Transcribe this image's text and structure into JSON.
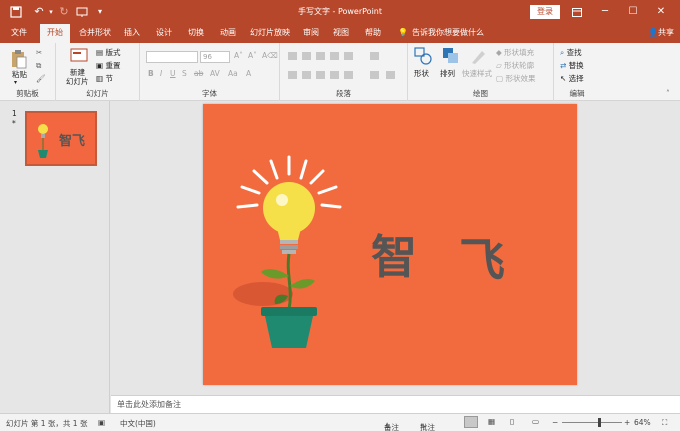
{
  "window": {
    "title": "手写文字 - PowerPoint",
    "login": "登录",
    "share": "共享",
    "tell_me": "告诉我你想要做什么"
  },
  "tabs": [
    {
      "label": "文件"
    },
    {
      "label": "开始"
    },
    {
      "label": "合并形状"
    },
    {
      "label": "插入"
    },
    {
      "label": "设计"
    },
    {
      "label": "切换"
    },
    {
      "label": "动画"
    },
    {
      "label": "幻灯片放映"
    },
    {
      "label": "审阅"
    },
    {
      "label": "视图"
    },
    {
      "label": "帮助"
    }
  ],
  "ribbon": {
    "clipboard": {
      "paste": "粘贴",
      "group": "剪贴板"
    },
    "slides": {
      "new_slide": "新建",
      "new_slide2": "幻灯片",
      "layout": "版式",
      "reset": "重置",
      "section": "节",
      "group": "幻灯片"
    },
    "font": {
      "font_size": "96",
      "group": "字体"
    },
    "paragraph": {
      "group": "段落"
    },
    "drawing": {
      "shapes": "形状",
      "arrange": "排列",
      "quick_styles": "快速样式",
      "fill": "形状填充",
      "outline": "形状轮廓",
      "effects": "形状效果",
      "group": "绘图"
    },
    "editing": {
      "find": "查找",
      "replace": "替换",
      "select": "选择",
      "group": "编辑"
    }
  },
  "thumbnail": {
    "number": "1",
    "star": "*"
  },
  "slide": {
    "char1": "智",
    "char2": "飞"
  },
  "notes_placeholder": "单击此处添加备注",
  "status": {
    "slide_count": "幻灯片 第 1 张，共 1 张",
    "language": "中文(中国)",
    "notes": "备注",
    "comments": "批注",
    "zoom": "64%"
  },
  "colors": {
    "accent": "#b7472a",
    "slide_bg": "#f26b3f",
    "pot": "#1f8a6f",
    "bulb": "#f6e04a"
  }
}
